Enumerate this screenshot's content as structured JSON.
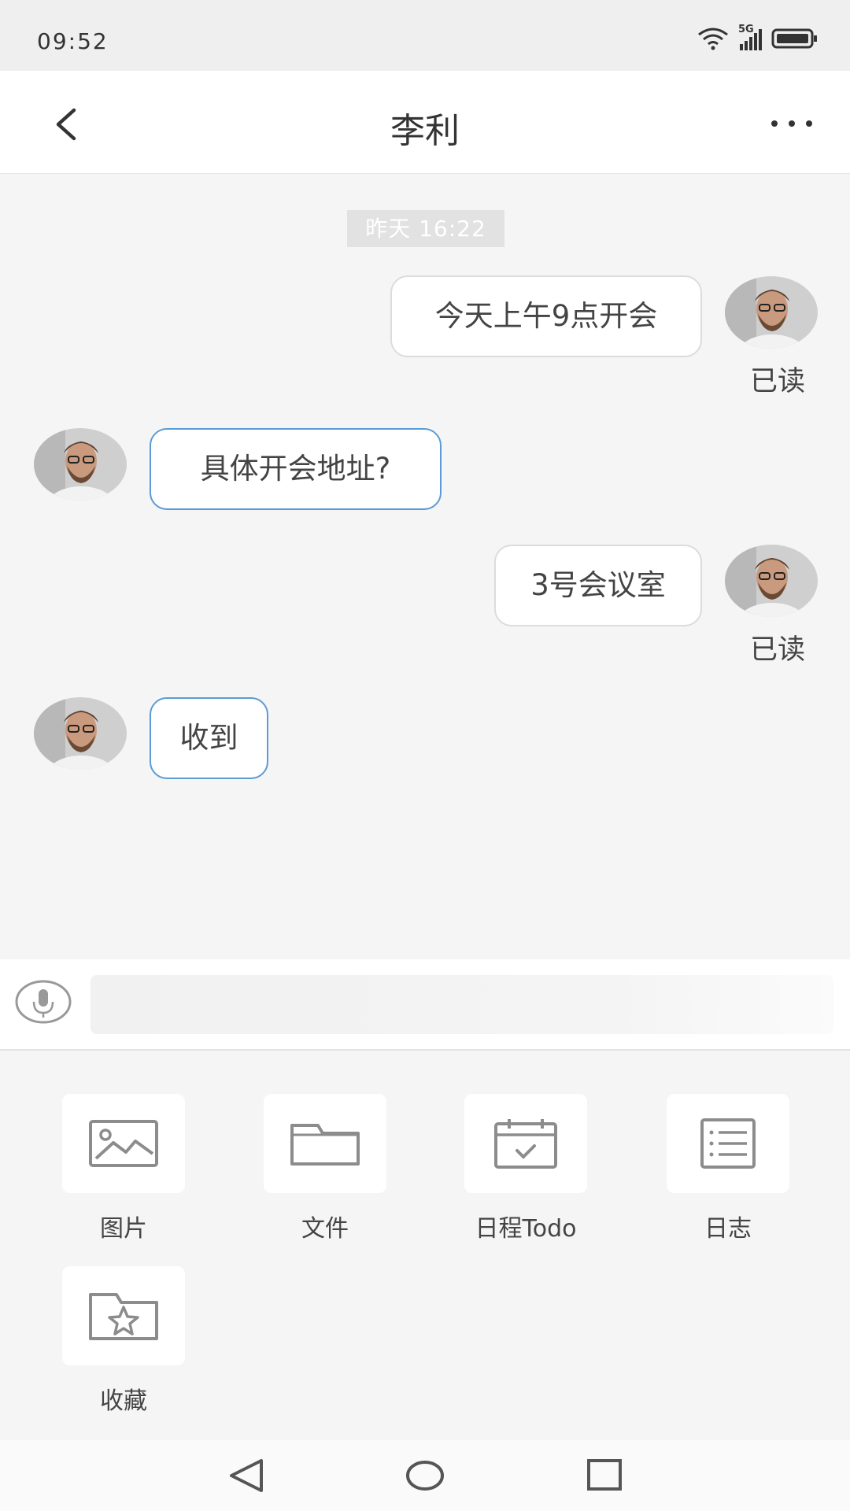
{
  "status_bar": {
    "time": "09:52",
    "network": "5G"
  },
  "header": {
    "title": "李利"
  },
  "chat": {
    "timestamp": "昨天 16:22",
    "messages": [
      {
        "direction": "out",
        "text": "今天上午9点开会",
        "status": "已读"
      },
      {
        "direction": "in",
        "text": "具体开会地址?"
      },
      {
        "direction": "out",
        "text": "3号会议室",
        "status": "已读"
      },
      {
        "direction": "in",
        "text": "收到"
      }
    ]
  },
  "input": {
    "placeholder": ""
  },
  "tools": [
    {
      "label": "图片",
      "icon": "image-icon"
    },
    {
      "label": "文件",
      "icon": "folder-icon"
    },
    {
      "label": "日程Todo",
      "icon": "calendar-icon"
    },
    {
      "label": "日志",
      "icon": "list-icon"
    },
    {
      "label": "收藏",
      "icon": "favorite-folder-icon"
    }
  ],
  "colors": {
    "incoming_border": "#5b9bd5",
    "outgoing_border": "#dcdcdc",
    "background": "#f5f5f6"
  }
}
